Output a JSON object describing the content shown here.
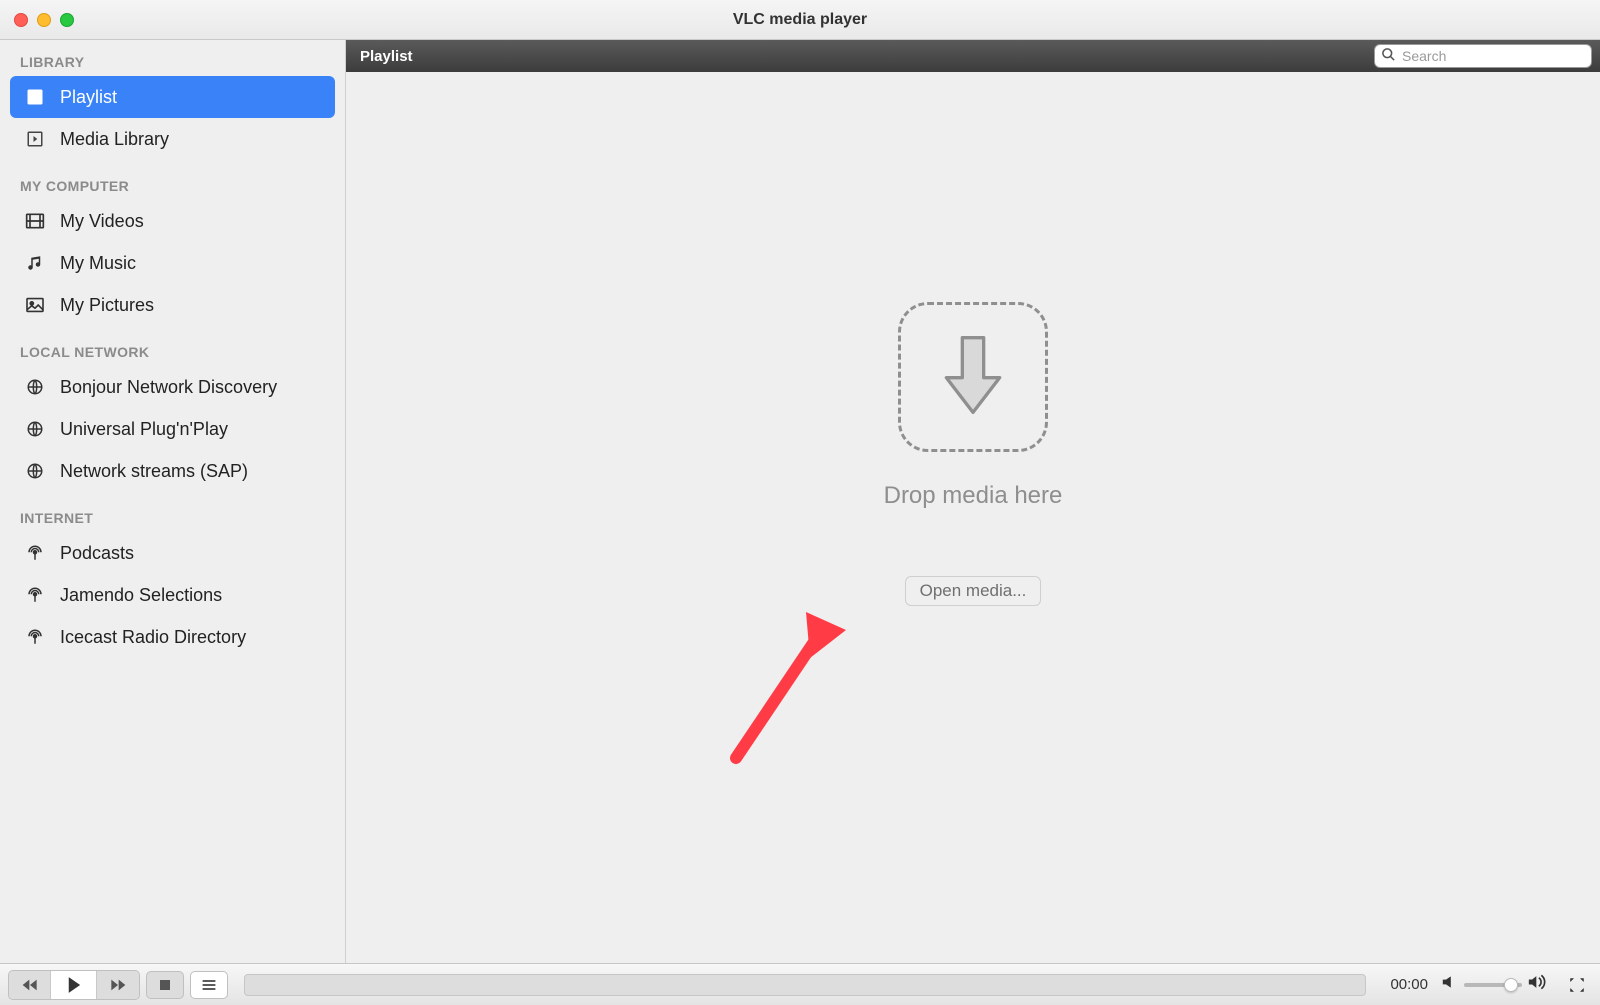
{
  "window": {
    "title": "VLC media player"
  },
  "sidebar": {
    "sections": {
      "library": {
        "label": "LIBRARY",
        "items": [
          {
            "label": "Playlist"
          },
          {
            "label": "Media Library"
          }
        ]
      },
      "my_computer": {
        "label": "MY COMPUTER",
        "items": [
          {
            "label": "My Videos"
          },
          {
            "label": "My Music"
          },
          {
            "label": "My Pictures"
          }
        ]
      },
      "local_network": {
        "label": "LOCAL NETWORK",
        "items": [
          {
            "label": "Bonjour Network Discovery"
          },
          {
            "label": "Universal Plug'n'Play"
          },
          {
            "label": "Network streams (SAP)"
          }
        ]
      },
      "internet": {
        "label": "INTERNET",
        "items": [
          {
            "label": "Podcasts"
          },
          {
            "label": "Jamendo Selections"
          },
          {
            "label": "Icecast Radio Directory"
          }
        ]
      }
    }
  },
  "content": {
    "header_title": "Playlist",
    "search_placeholder": "Search",
    "drop_text": "Drop media here",
    "open_media_label": "Open media..."
  },
  "controls": {
    "time_label": "00:00"
  },
  "colors": {
    "selection": "#3a82f7",
    "annotation_arrow": "#ff3b46"
  }
}
